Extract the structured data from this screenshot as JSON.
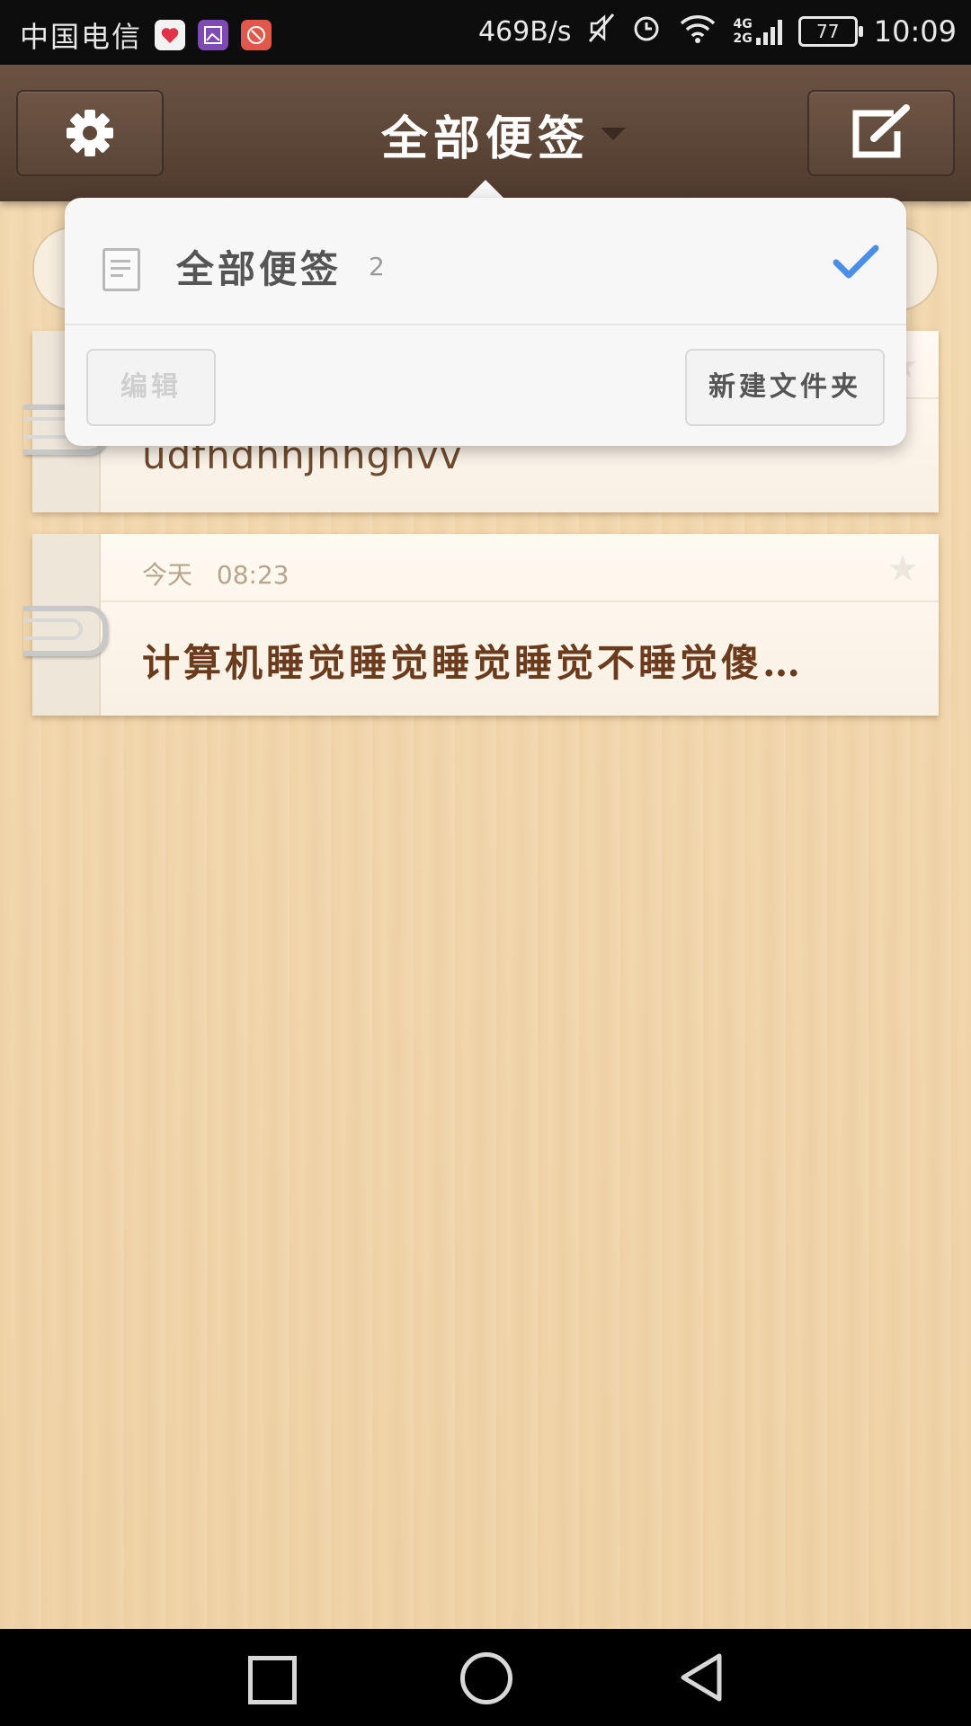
{
  "status_bar": {
    "carrier": "中国电信",
    "speed": "469B/s",
    "network_top": "4G",
    "network_bottom": "2G",
    "battery": "77",
    "time": "10:09"
  },
  "header": {
    "title": "全部便签",
    "settings_icon": "gear-icon",
    "compose_icon": "compose-icon"
  },
  "notes": [
    {
      "body": "udfhdhhjhhghvv",
      "starred": false
    },
    {
      "date_label": "今天",
      "time": "08:23",
      "body": "计算机睡觉睡觉睡觉睡觉不睡觉傻…",
      "starred": false
    }
  ],
  "folder_popup": {
    "folders": [
      {
        "name": "全部便签",
        "count": "2",
        "selected": true
      }
    ],
    "edit_label": "编辑",
    "new_folder_label": "新建文件夹"
  },
  "colors": {
    "header_bg": "#5b4536",
    "wood_bg": "#f3d9b0",
    "note_text": "#6a3b1c",
    "check": "#4a8ee8"
  }
}
